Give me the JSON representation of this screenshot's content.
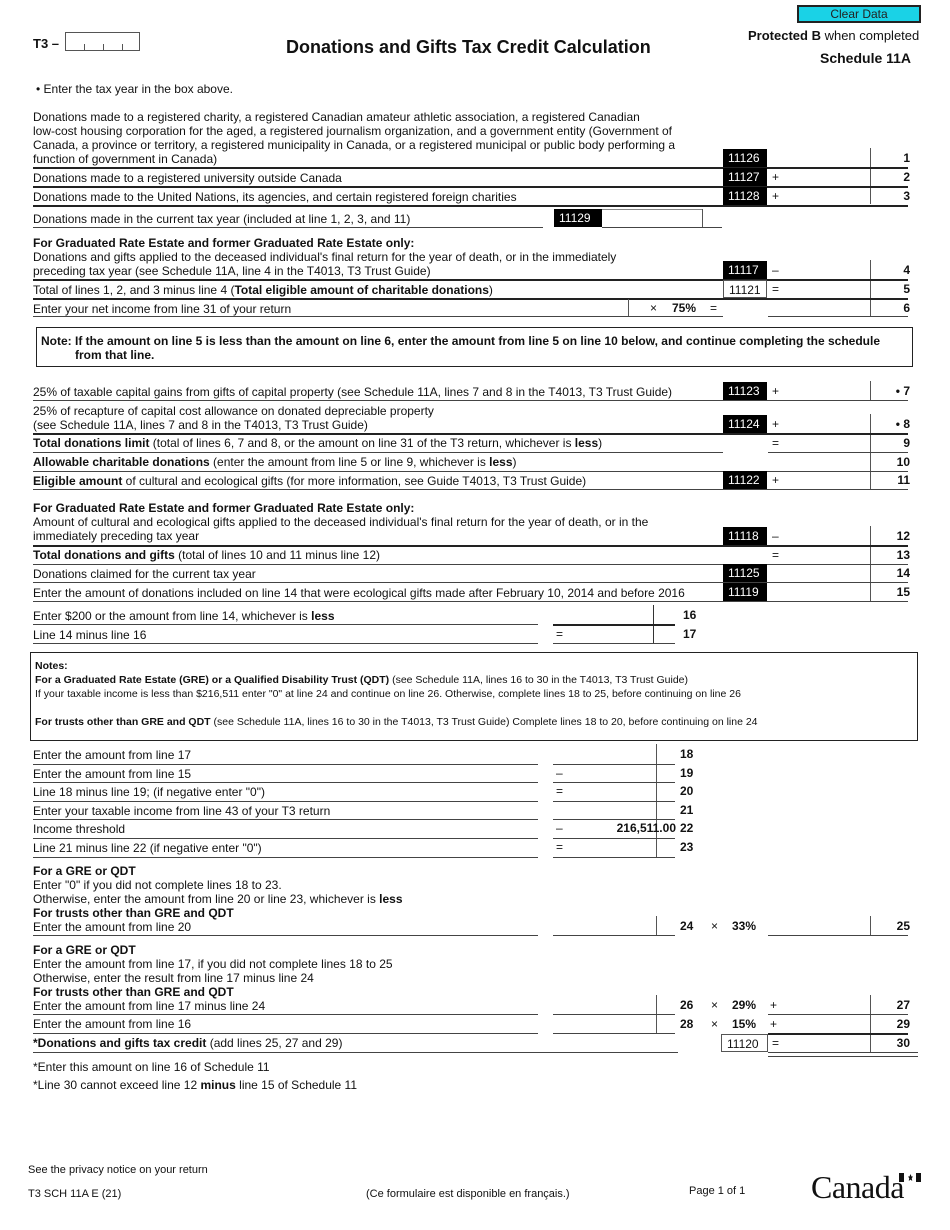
{
  "header": {
    "form_prefix": "T3 –",
    "title": "Donations and Gifts Tax Credit Calculation",
    "clear_button": "Clear Data",
    "protected_bold": "Protected B",
    "protected_rest": " when completed",
    "schedule": "Schedule 11A",
    "tax_year_instruction": "•  Enter the tax year in the box above."
  },
  "colors": {
    "clear_button_bg": "#1ad2e6",
    "code_bg": "#000000"
  },
  "lines": {
    "l1": {
      "text": [
        "Donations made to a registered charity, a registered Canadian amateur athletic association, a registered Canadian",
        "low-cost housing corporation for the aged, a registered journalism organization, and a government entity (Government of",
        "Canada, a province or territory, a registered municipality in Canada, or a registered municipal or public body performing a",
        "function of government in Canada)"
      ],
      "code": "11126",
      "op": "",
      "num": "1"
    },
    "l2": {
      "text": "Donations made to a registered university outside Canada",
      "code": "11127",
      "op": "+",
      "num": "2"
    },
    "l3": {
      "text": "Donations made to the United Nations, its agencies, and certain registered foreign charities",
      "code": "11128",
      "op": "+",
      "num": "3"
    },
    "l11129": {
      "text": "Donations made in the current tax year (included at line 1, 2, 3, and 11)",
      "code": "11129"
    },
    "gre_heading": "For Graduated Rate Estate and former Graduated Rate Estate only:",
    "l4": {
      "text": [
        "Donations and gifts applied to the deceased individual's final return for the year of death, or in the immediately",
        "preceding tax year (see Schedule 11A, line 4 in the T4013, T3 Trust Guide)"
      ],
      "code": "11117",
      "op": "–",
      "num": "4"
    },
    "l5": {
      "text_pre": "Total of lines 1, 2, and 3 minus line 4 (",
      "text_bold": "Total eligible amount of charitable donations",
      "text_post": ")",
      "code": "11121",
      "op": "=",
      "num": "5"
    },
    "l6": {
      "text": "Enter your net income from line 31 of your return",
      "mult": "×",
      "pct": "75%",
      "op": "=",
      "num": "6"
    },
    "note1": [
      "Note: If the amount on line 5 is less than the amount on line 6, enter the amount from line 5 on line 10 below, and continue completing the schedule",
      "from that line."
    ],
    "l7": {
      "text": "25% of taxable capital gains from gifts of capital property (see Schedule 11A, lines 7 and 8 in the T4013, T3 Trust Guide)",
      "code": "11123",
      "op": "+",
      "num": "• 7"
    },
    "l8": {
      "text": [
        "25% of recapture of capital cost allowance on donated depreciable property",
        "(see Schedule 11A, lines 7 and 8 in the T4013, T3 Trust Guide)"
      ],
      "code": "11124",
      "op": "+",
      "num": "• 8"
    },
    "l9": {
      "bold": "Total donations limit",
      "pre": " (total of lines 6, 7 and 8, or the amount on line 31 of the T3 return, whichever is ",
      "bold2": "less",
      "post": ")",
      "op": "=",
      "num": "9"
    },
    "l10": {
      "bold": "Allowable charitable donations",
      "pre": " (enter the amount from line 5 or line 9, whichever is ",
      "bold2": "less",
      "post": ")",
      "num": "10"
    },
    "l11": {
      "bold": "Eligible amount",
      "pre": " of cultural and ecological gifts (for more information, see Guide T4013, T3 Trust Guide)",
      "code": "11122",
      "op": "+",
      "num": "11"
    },
    "gre_heading2": "For Graduated Rate Estate and former Graduated Rate Estate only:",
    "l12": {
      "text": [
        "Amount of cultural and ecological gifts applied to the deceased individual's final return for the year of death, or in the",
        "immediately preceding tax year"
      ],
      "code": "11118",
      "op": "–",
      "num": "12"
    },
    "l13": {
      "bold": "Total donations and gifts",
      "pre": " (total of lines 10 and 11 minus line 12)",
      "op": "=",
      "num": "13"
    },
    "l14": {
      "text": "Donations claimed for the current tax year",
      "code": "11125",
      "num": "14"
    },
    "l15": {
      "text": "Enter the amount of donations included on line 14 that were ecological gifts made after February 10, 2014 and before 2016",
      "code": "11119",
      "num": "15"
    },
    "l16": {
      "pre": "Enter $200 or the amount from line 14, whichever is ",
      "bold": "less",
      "num": "16"
    },
    "l17": {
      "text": "Line 14 minus line 16",
      "op": "=",
      "num": "17"
    },
    "notes2": {
      "title": "Notes:",
      "gre_bold": "For a Graduated Rate Estate (GRE) or a Qualified Disability Trust (QDT)",
      "gre_rest": " (see Schedule 11A, lines 16 to 30 in the T4013, T3 Trust Guide)",
      "gre_line2": "If your taxable income is less than $216,511 enter \"0\" at line 24 and continue on line 26. Otherwise, complete lines 18 to 25, before continuing on line 26",
      "other_bold": "For trusts other than GRE and QDT",
      "other_rest": " (see Schedule 11A, lines 16 to 30 in the T4013, T3 Trust Guide) Complete lines 18 to 20, before continuing on line 24"
    },
    "l18": {
      "text": "Enter the amount from line 17",
      "num": "18"
    },
    "l19": {
      "text": "Enter the amount from line 15",
      "op": "–",
      "num": "19"
    },
    "l20": {
      "text": "Line 18 minus line 19; (if negative enter \"0\")",
      "op": "=",
      "num": "20"
    },
    "l21": {
      "text": "Enter your taxable income from line 43 of your T3 return",
      "num": "21"
    },
    "l22": {
      "text": "Income threshold",
      "op": "–",
      "value": "216,511.00",
      "num": "22"
    },
    "l23": {
      "text": "Line 21 minus line 22 (if negative enter \"0\")",
      "op": "=",
      "num": "23"
    },
    "l24": {
      "h1": "For a GRE or QDT",
      "t1": "Enter \"0\" if you did not complete lines 18 to 23.",
      "t2_pre": "Otherwise, enter the amount from line 20 or line 23, whichever is ",
      "t2_bold": "less",
      "h2": "For trusts other than GRE and QDT",
      "t3": "Enter the amount from line 20",
      "num": "24",
      "mult": "×",
      "pct": "33%",
      "num2": "25"
    },
    "l26": {
      "h1": "For a GRE or QDT",
      "t1": "Enter the amount from line 17, if you did not complete lines 18 to 25",
      "t2": "Otherwise, enter the result from line 17 minus line 24",
      "h2": "For trusts other than GRE and QDT",
      "t3": "Enter the amount from line 17 minus line 24",
      "num": "26",
      "mult": "×",
      "pct": "29%",
      "op": "+",
      "num2": "27"
    },
    "l28": {
      "text": "Enter the amount from line 16",
      "num": "28",
      "mult": "×",
      "pct": "15%",
      "op": "+",
      "num2": "29"
    },
    "l30": {
      "bold": "*Donations and gifts tax credit",
      "pre": " (add lines 25, 27 and 29)",
      "code": "11120",
      "op": "=",
      "num": "30"
    },
    "foot1": "*Enter this amount on line 16 of Schedule 11",
    "foot2_pre": "*Line 30 cannot exceed line 12 ",
    "foot2_bold": "minus",
    "foot2_post": " line 15 of Schedule 11"
  },
  "footer": {
    "privacy": "See the privacy notice on your return",
    "form_code": "T3 SCH 11A E (21)",
    "french": "(Ce formulaire est disponible en français.)",
    "page": "Page 1 of 1",
    "wordmark": "Canada"
  }
}
